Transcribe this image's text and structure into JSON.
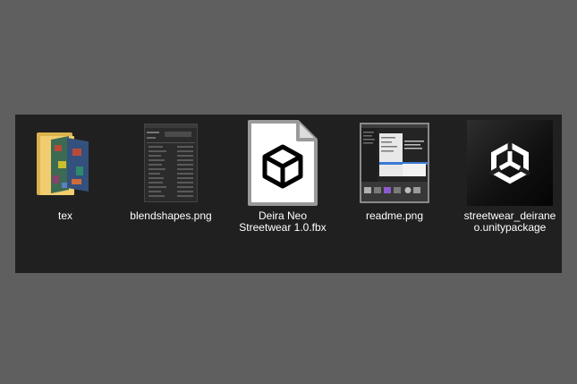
{
  "files": [
    {
      "name": "tex",
      "icon": "folder-icon"
    },
    {
      "name": "blendshapes.png",
      "icon": "image-thumbnail-icon"
    },
    {
      "name": "Deira Neo Streetwear 1.0.fbx",
      "icon": "3d-model-file-icon"
    },
    {
      "name": "readme.png",
      "icon": "image-thumbnail-icon"
    },
    {
      "name": "streetwear_deiraneo.unitypackage",
      "icon": "unity-logo-icon"
    }
  ],
  "colors": {
    "background": "#5f5f5f",
    "panel": "#202020",
    "folder": "#f0cd6e",
    "label_text": "#ffffff"
  }
}
